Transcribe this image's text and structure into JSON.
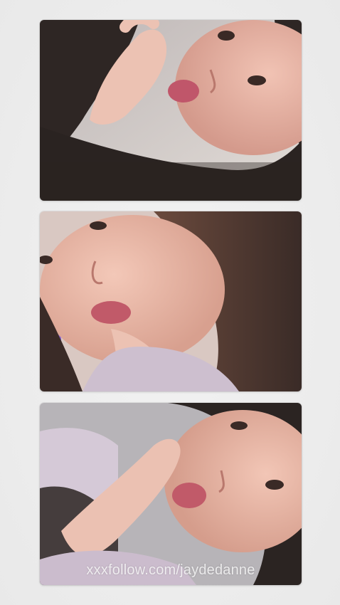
{
  "watermark": {
    "text": "xxxfollow.com/jaydedanne"
  },
  "colors": {
    "background": "#ededed",
    "skin": "#e9b7a6",
    "hair": "#2b2422",
    "lips": "#c15a69",
    "clothing": "#c9b9c9"
  },
  "photos": [
    {
      "description_icon": "selfie-photo-icon"
    },
    {
      "description_icon": "selfie-photo-icon"
    },
    {
      "description_icon": "selfie-photo-icon"
    }
  ]
}
